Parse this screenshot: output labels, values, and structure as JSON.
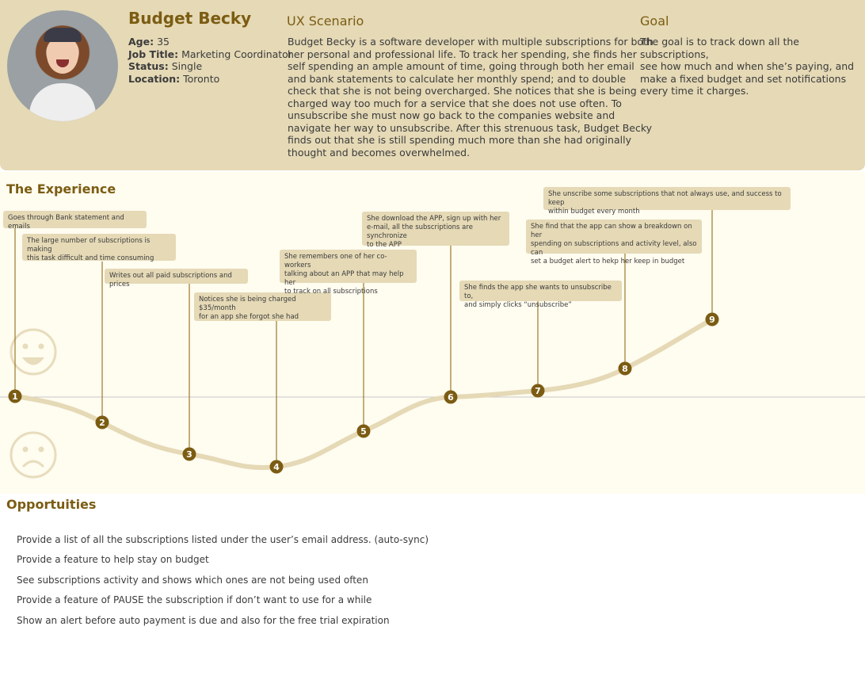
{
  "persona": {
    "name": "Budget Becky",
    "age_label": "Age:",
    "age": " 35",
    "job_label": "Job Title:",
    "job": " Marketing Coordinator",
    "status_label": "Status:",
    "status": " Single",
    "location_label": "Location:",
    "location": " Toronto"
  },
  "scenario": {
    "title": "UX Scenario",
    "lines": [
      "Budget Becky is a software developer with multiple subscriptions for both",
      "her personal and professional life. To track her spending, she finds her",
      "self spending an ample amount of time, going through both her email",
      "and bank statements to calculate her monthly spend; and to  double",
      "check that she is not being overcharged. She notices that she is being",
      "charged way too much for a service that she does not use often. To",
      "unsubscribe she must now go back to the companies website and",
      "navigate her way to unsubscribe. After this strenuous task, Budget Becky",
      "finds out that she is still spending much more than she had originally",
      "thought and becomes overwhelmed."
    ]
  },
  "goal": {
    "title": "Goal",
    "lines": [
      "The goal is to track down all the subscriptions,",
      "see how much and when she’s paying, and",
      "make a fixed budget and set notifications",
      "every time it charges."
    ]
  },
  "experience": {
    "title": "The Experience",
    "colors": {
      "curve": "#e5d9b6",
      "marker": "#7b5c12",
      "stem": "#9b7a2a",
      "face": "#e7dcbc"
    },
    "steps": [
      {
        "number": "1",
        "lines": [
          "Goes through Bank statement and emails"
        ]
      },
      {
        "number": "2",
        "lines": [
          "The large number of subscriptions is making",
          "this task difficult and time consuming"
        ]
      },
      {
        "number": "3",
        "lines": [
          "Writes out all paid subscriptions and prices"
        ]
      },
      {
        "number": "4",
        "lines": [
          "Notices she is being charged $35/month",
          "for an app she forgot she had"
        ]
      },
      {
        "number": "5",
        "lines": [
          "She remembers one of her co-workers",
          "talking about an APP that may help her",
          "to track on all subscriptions"
        ]
      },
      {
        "number": "6",
        "lines": [
          "She download the APP, sign up with her",
          "e-mail, all the subscriptions are synchronize",
          "to the APP"
        ]
      },
      {
        "number": "7",
        "lines": [
          "She finds the app she wants to unsubscribe to,",
          "and simply clicks “unsubscribe”"
        ]
      },
      {
        "number": "8",
        "lines": [
          "She find that the app can show a breakdown on her",
          "spending on subscriptions and activity level, also can",
          "set a budget alert to hekp her keep in budget"
        ]
      },
      {
        "number": "9",
        "lines": [
          "She unscribe some subscriptions that not always use, and success to keep",
          "within budget every month"
        ]
      }
    ]
  },
  "opportunities": {
    "title": "Opportuities",
    "items": [
      "Provide a list of all the subscriptions listed under the user’s email address. (auto-sync)",
      "Provide a feature to help stay on budget",
      " See subscriptions activity and shows which ones are not being used often",
      "Provide a feature of PAUSE the subscription if don’t want to use for a while",
      "Show an alert before auto payment is due and also for the free trial expiration"
    ]
  }
}
